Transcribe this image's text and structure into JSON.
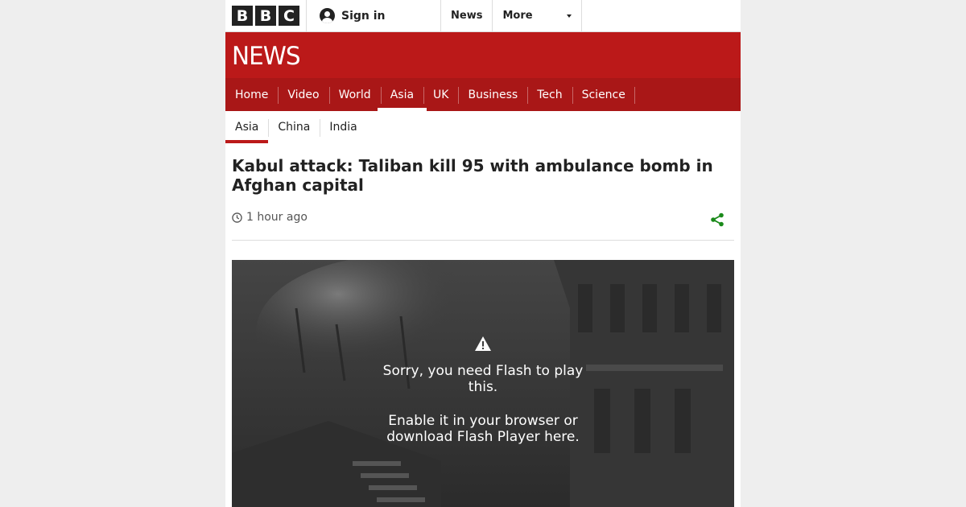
{
  "brand": {
    "logo_letters": [
      "B",
      "B",
      "C"
    ],
    "wordmark": "NEWS"
  },
  "topbar": {
    "signin_label": "Sign in",
    "news_label": "News",
    "more_label": "More"
  },
  "primary_nav": {
    "items": [
      {
        "label": "Home"
      },
      {
        "label": "Video"
      },
      {
        "label": "World"
      },
      {
        "label": "Asia",
        "active": true
      },
      {
        "label": "UK"
      },
      {
        "label": "Business"
      },
      {
        "label": "Tech"
      },
      {
        "label": "Science"
      }
    ]
  },
  "secondary_nav": {
    "items": [
      {
        "label": "Asia",
        "active": true
      },
      {
        "label": "China"
      },
      {
        "label": "India"
      }
    ]
  },
  "article": {
    "headline": "Kabul attack: Taliban kill 95 with ambulance bomb in Afghan capital",
    "timestamp": "1 hour ago"
  },
  "media": {
    "message_line1": "Sorry, you need Flash to play this.",
    "message_line2": "Enable it in your browser or download Flash Player here."
  },
  "colors": {
    "brand_red": "#bb1919",
    "nav_red": "#a91717",
    "share_green": "#1a8a1a",
    "page_bg": "#eeeeee"
  },
  "icons": [
    "person-icon",
    "caret-down-icon",
    "clock-icon",
    "share-icon",
    "warning-icon"
  ]
}
